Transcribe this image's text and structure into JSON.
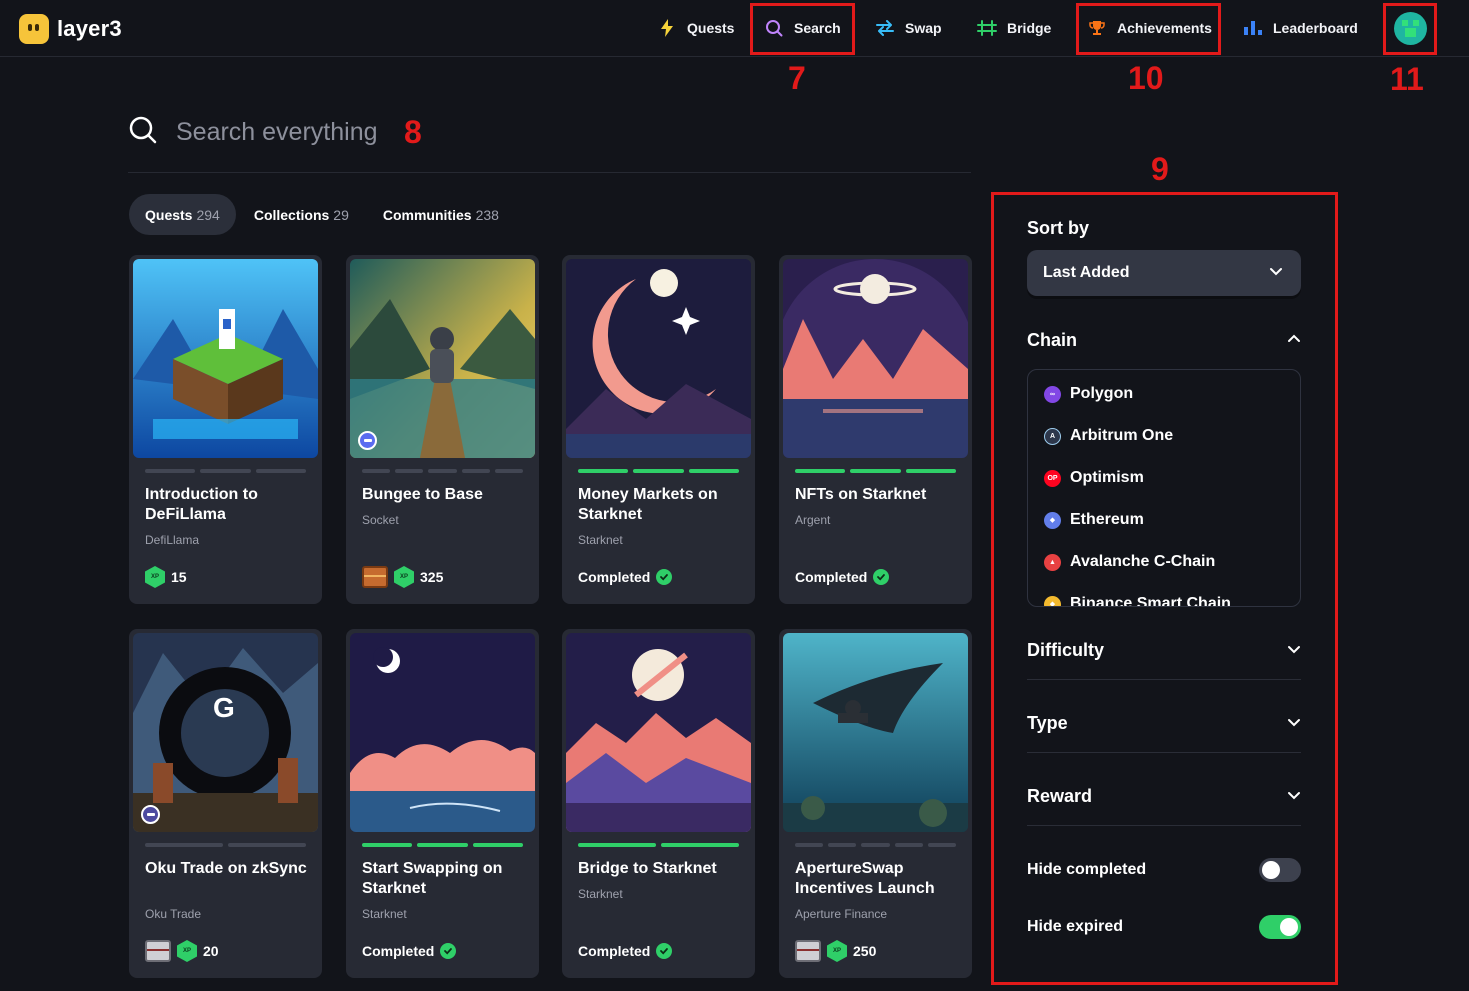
{
  "brand": {
    "name": "layer3"
  },
  "nav": {
    "quests": "Quests",
    "search": "Search",
    "swap": "Swap",
    "bridge": "Bridge",
    "achievements": "Achievements",
    "leaderboard": "Leaderboard"
  },
  "annotations": {
    "n7": "7",
    "n8": "8",
    "n9": "9",
    "n10": "10",
    "n11": "11",
    "color": "#e21a1a"
  },
  "search": {
    "placeholder": "Search everything",
    "value": ""
  },
  "tabs": [
    {
      "label": "Quests",
      "count": "294"
    },
    {
      "label": "Collections",
      "count": "29"
    },
    {
      "label": "Communities",
      "count": "238"
    }
  ],
  "cards": [
    {
      "title": "Introduction to DeFiLlama",
      "subtitle": "DefiLlama",
      "xp": "15",
      "status": "",
      "progress_done": 0,
      "progress_total": 3
    },
    {
      "title": "Bungee to Base",
      "subtitle": "Socket",
      "xp": "325",
      "status": "",
      "progress_done": 0,
      "progress_total": 5
    },
    {
      "title": "Money Markets on Starknet",
      "subtitle": "Starknet",
      "xp": "",
      "status": "Completed",
      "progress_done": 3,
      "progress_total": 3
    },
    {
      "title": "NFTs on Starknet",
      "subtitle": "Argent",
      "xp": "",
      "status": "Completed",
      "progress_done": 3,
      "progress_total": 3
    },
    {
      "title": "Oku Trade on zkSync",
      "subtitle": "Oku Trade",
      "xp": "20",
      "status": "",
      "progress_done": 0,
      "progress_total": 2
    },
    {
      "title": "Start Swapping on Starknet",
      "subtitle": "Starknet",
      "xp": "",
      "status": "Completed",
      "progress_done": 3,
      "progress_total": 3
    },
    {
      "title": "Bridge to Starknet",
      "subtitle": "Starknet",
      "xp": "",
      "status": "Completed",
      "progress_done": 2,
      "progress_total": 2
    },
    {
      "title": "ApertureSwap Incentives Launch",
      "subtitle": "Aperture Finance",
      "xp": "250",
      "status": "",
      "progress_done": 0,
      "progress_total": 5
    }
  ],
  "xp_badge_text": "XP",
  "filters": {
    "sort_label": "Sort by",
    "sort_value": "Last Added",
    "chain_label": "Chain",
    "chains": [
      {
        "name": "Polygon",
        "color": "#8247e5"
      },
      {
        "name": "Arbitrum One",
        "color": "#2d374b"
      },
      {
        "name": "Optimism",
        "color": "#ff0420"
      },
      {
        "name": "Ethereum",
        "color": "#627eea"
      },
      {
        "name": "Avalanche C-Chain",
        "color": "#e84142"
      },
      {
        "name": "Binance Smart Chain",
        "color": "#f3ba2f"
      }
    ],
    "difficulty_label": "Difficulty",
    "type_label": "Type",
    "reward_label": "Reward",
    "hide_completed_label": "Hide completed",
    "hide_completed": false,
    "hide_expired_label": "Hide expired",
    "hide_expired": true
  },
  "colors": {
    "accent_green": "#2fcf68",
    "background": "#12141a",
    "card": "#272a34"
  }
}
